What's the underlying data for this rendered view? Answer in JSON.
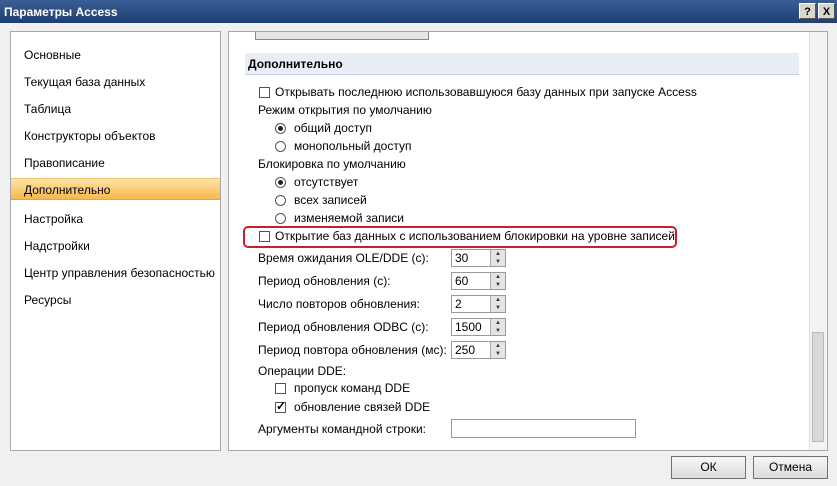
{
  "window": {
    "title": "Параметры Access",
    "help_glyph": "?",
    "close_glyph": "X"
  },
  "sidebar": {
    "items": [
      {
        "label": "Основные",
        "selected": false
      },
      {
        "label": "Текущая база данных",
        "selected": false
      },
      {
        "label": "Таблица",
        "selected": false
      },
      {
        "label": "Конструкторы объектов",
        "selected": false
      },
      {
        "label": "Правописание",
        "selected": false
      },
      {
        "label": "Дополнительно",
        "selected": true
      },
      {
        "label": "Настройка",
        "selected": false
      },
      {
        "label": "Надстройки",
        "selected": false
      },
      {
        "label": "Центр управления безопасностью",
        "selected": false
      },
      {
        "label": "Ресурсы",
        "selected": false
      }
    ]
  },
  "main": {
    "section_title": "Дополнительно",
    "open_last": {
      "label": "Открывать последнюю использовавшуюся базу данных при запуске Access",
      "checked": false
    },
    "open_mode": {
      "label": "Режим открытия по умолчанию",
      "options": [
        "общий доступ",
        "монопольный доступ"
      ],
      "selected": 0
    },
    "lock": {
      "label": "Блокировка по умолчанию",
      "options": [
        "отсутствует",
        "всех записей",
        "изменяемой записи"
      ],
      "selected": 0
    },
    "record_lock": {
      "label": "Открытие баз данных с использованием блокировки на уровне записей",
      "checked": false
    },
    "fields": [
      {
        "label": "Время ожидания OLE/DDE (с):",
        "value": "30"
      },
      {
        "label": "Период обновления (с):",
        "value": "60"
      },
      {
        "label": "Число повторов обновления:",
        "value": "2"
      },
      {
        "label": "Период обновления ODBC (с):",
        "value": "1500"
      },
      {
        "label": "Период повтора обновления (мс):",
        "value": "250"
      }
    ],
    "dde": {
      "label": "Операции DDE:",
      "ignore": {
        "label": "пропуск команд DDE",
        "checked": false
      },
      "refresh": {
        "label": "обновление связей DDE",
        "checked": true
      }
    },
    "cmdline": {
      "label": "Аргументы командной строки:",
      "value": ""
    }
  },
  "footer": {
    "ok_label": "ОК",
    "cancel_label": "Отмена"
  },
  "colors": {
    "highlight_border": "#c8202a",
    "selected_item": "#f7b84e",
    "titlebar": "#1f3f73"
  }
}
